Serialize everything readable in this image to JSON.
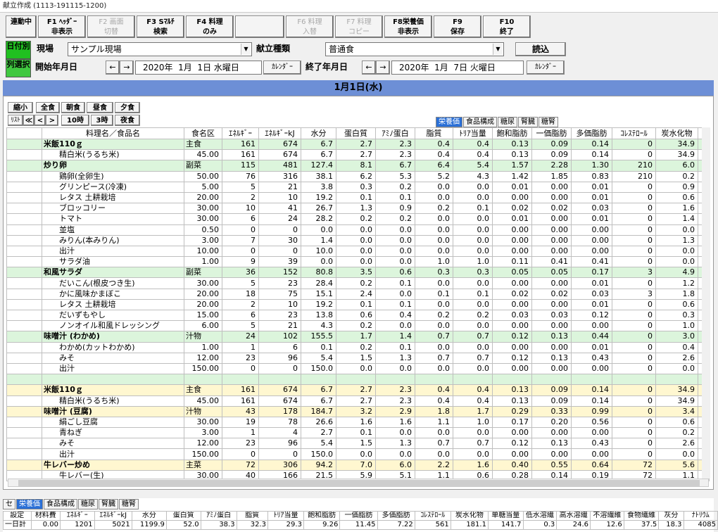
{
  "window": {
    "title": "献立作成 (1113-191115-1200)"
  },
  "fkeys": [
    {
      "l1": "連動中",
      "l2": "",
      "disabled": false
    },
    {
      "l1": "F1 ﾍｯﾀﾞｰ",
      "l2": "非表示",
      "disabled": false
    },
    {
      "l1": "F2  画面",
      "l2": "切替",
      "disabled": true
    },
    {
      "l1": "F3  Sﾏﾙﾁ",
      "l2": "検索",
      "disabled": false
    },
    {
      "l1": "F4  料理",
      "l2": "のみ",
      "disabled": false
    },
    {
      "l1": "",
      "l2": "",
      "disabled": false
    },
    {
      "l1": "F6  料理",
      "l2": "入替",
      "disabled": true
    },
    {
      "l1": "F7  料理",
      "l2": "コピー",
      "disabled": true
    },
    {
      "l1": "F8栄養価",
      "l2": "非表示",
      "disabled": false
    },
    {
      "l1": "F9",
      "l2": "保存",
      "disabled": false
    },
    {
      "l1": "F10",
      "l2": "終了",
      "disabled": false
    }
  ],
  "header": {
    "day_btn": "日付別",
    "list_btn": "列選択",
    "site_label": "現場",
    "site_value": "サンプル現場",
    "menu_type_label": "献立種類",
    "menu_type_value": "普通食",
    "load_btn": "読込",
    "start_label": "開始年月日",
    "start_date": "2020年  1月  1日 水曜日",
    "end_label": "終了年月日",
    "end_date": "2020年  1月  7日 火曜日",
    "calendar_btn": "ｶﾚﾝﾀﾞｰ",
    "prev": "←",
    "next": "→"
  },
  "day_title": "1月1日(水)",
  "meal_buttons": {
    "shrink": "縮小",
    "all": "全食",
    "breakfast": "朝食",
    "lunch": "昼食",
    "dinner": "夕食",
    "list": "ﾘｽﾄ",
    "first": "≪",
    "prev": "<",
    "next": ">",
    "ten": "10時",
    "three": "3時",
    "night": "夜食"
  },
  "top_tabs": [
    "栄養価",
    "食品構成",
    "糖尿",
    "腎臓",
    "糖腎"
  ],
  "columns": [
    "料理名／食品名",
    "食名区",
    "ｴﾈﾙｷﾞｰ",
    "ｴﾈﾙｷﾞｰkJ",
    "水分",
    "蛋白質",
    "ｱﾐﾉ蛋白",
    "脂質",
    "ﾄﾘｱ当量",
    "飽和脂肪",
    "一価脂肪",
    "多価脂肪",
    "ｺﾚｽﾃﾛｰﾙ",
    "炭水化物"
  ],
  "rows": [
    {
      "t": "dish",
      "c": "g",
      "name": "米飯110ｇ",
      "cat": "主食",
      "v": [
        "161",
        "674",
        "6.7",
        "2.7",
        "2.3",
        "0.4",
        "0.4",
        "0.13",
        "0.09",
        "0.14",
        "0",
        "34.9"
      ]
    },
    {
      "t": "ing",
      "name": "精白米(うるち米)",
      "cat": "45.00",
      "v": [
        "161",
        "674",
        "6.7",
        "2.7",
        "2.3",
        "0.4",
        "0.4",
        "0.13",
        "0.09",
        "0.14",
        "0",
        "34.9"
      ]
    },
    {
      "t": "dish",
      "c": "g",
      "name": "炒り卵",
      "cat": "副菜",
      "v": [
        "115",
        "481",
        "127.4",
        "8.1",
        "6.7",
        "6.4",
        "5.4",
        "1.57",
        "2.28",
        "1.30",
        "210",
        "6.0"
      ]
    },
    {
      "t": "ing",
      "name": "鶏卵(全卵生)",
      "cat": "50.00",
      "v": [
        "76",
        "316",
        "38.1",
        "6.2",
        "5.3",
        "5.2",
        "4.3",
        "1.42",
        "1.85",
        "0.83",
        "210",
        "0.2"
      ]
    },
    {
      "t": "ing",
      "name": "グリンピース(冷凍)",
      "cat": "5.00",
      "v": [
        "5",
        "21",
        "3.8",
        "0.3",
        "0.2",
        "0.0",
        "0.0",
        "0.01",
        "0.00",
        "0.01",
        "0",
        "0.9"
      ]
    },
    {
      "t": "ing",
      "name": "レタス 土耕栽培",
      "cat": "20.00",
      "v": [
        "2",
        "10",
        "19.2",
        "0.1",
        "0.1",
        "0.0",
        "0.0",
        "0.00",
        "0.00",
        "0.01",
        "0",
        "0.6"
      ]
    },
    {
      "t": "ing",
      "name": "ブロッコリー",
      "cat": "30.00",
      "v": [
        "10",
        "41",
        "26.7",
        "1.3",
        "0.9",
        "0.2",
        "0.1",
        "0.02",
        "0.02",
        "0.03",
        "0",
        "1.6"
      ]
    },
    {
      "t": "ing",
      "name": "トマト",
      "cat": "30.00",
      "v": [
        "6",
        "24",
        "28.2",
        "0.2",
        "0.2",
        "0.0",
        "0.0",
        "0.01",
        "0.00",
        "0.01",
        "0",
        "1.4"
      ]
    },
    {
      "t": "ing",
      "name": "並塩",
      "cat": "0.50",
      "v": [
        "0",
        "0",
        "0.0",
        "0.0",
        "0.0",
        "0.0",
        "0.0",
        "0.00",
        "0.00",
        "0.00",
        "0",
        "0.0"
      ]
    },
    {
      "t": "ing",
      "name": "みりん(本みりん)",
      "cat": "3.00",
      "v": [
        "7",
        "30",
        "1.4",
        "0.0",
        "0.0",
        "0.0",
        "0.0",
        "0.00",
        "0.00",
        "0.00",
        "0",
        "1.3"
      ]
    },
    {
      "t": "ing",
      "name": "出汁",
      "cat": "10.00",
      "v": [
        "0",
        "0",
        "10.0",
        "0.0",
        "0.0",
        "0.0",
        "0.0",
        "0.00",
        "0.00",
        "0.00",
        "0",
        "0.0"
      ]
    },
    {
      "t": "ing",
      "name": "サラダ油",
      "cat": "1.00",
      "v": [
        "9",
        "39",
        "0.0",
        "0.0",
        "0.0",
        "1.0",
        "1.0",
        "0.11",
        "0.41",
        "0.41",
        "0",
        "0.0"
      ]
    },
    {
      "t": "dish",
      "c": "g",
      "name": "和風サラダ",
      "cat": "副菜",
      "v": [
        "36",
        "152",
        "80.8",
        "3.5",
        "0.6",
        "0.3",
        "0.3",
        "0.05",
        "0.05",
        "0.17",
        "3",
        "4.9"
      ]
    },
    {
      "t": "ing",
      "name": "だいこん(根皮つき生)",
      "cat": "30.00",
      "v": [
        "5",
        "23",
        "28.4",
        "0.2",
        "0.1",
        "0.0",
        "0.0",
        "0.00",
        "0.00",
        "0.01",
        "0",
        "1.2"
      ]
    },
    {
      "t": "ing",
      "name": "かに風味かまぼこ",
      "cat": "20.00",
      "v": [
        "18",
        "75",
        "15.1",
        "2.4",
        "0.0",
        "0.1",
        "0.1",
        "0.02",
        "0.02",
        "0.03",
        "3",
        "1.8"
      ]
    },
    {
      "t": "ing",
      "name": "レタス 土耕栽培",
      "cat": "20.00",
      "v": [
        "2",
        "10",
        "19.2",
        "0.1",
        "0.1",
        "0.0",
        "0.0",
        "0.00",
        "0.00",
        "0.01",
        "0",
        "0.6"
      ]
    },
    {
      "t": "ing",
      "name": "だいずもやし",
      "cat": "15.00",
      "v": [
        "6",
        "23",
        "13.8",
        "0.6",
        "0.4",
        "0.2",
        "0.2",
        "0.03",
        "0.03",
        "0.12",
        "0",
        "0.3"
      ]
    },
    {
      "t": "ing",
      "name": "ノンオイル和風ドレッシング",
      "cat": "6.00",
      "v": [
        "5",
        "21",
        "4.3",
        "0.2",
        "0.0",
        "0.0",
        "0.0",
        "0.00",
        "0.00",
        "0.00",
        "0",
        "1.0"
      ]
    },
    {
      "t": "dish",
      "c": "g",
      "name": "味噌汁 (わかめ)",
      "cat": "汁物",
      "v": [
        "24",
        "102",
        "155.5",
        "1.7",
        "1.4",
        "0.7",
        "0.7",
        "0.12",
        "0.13",
        "0.44",
        "0",
        "3.0"
      ]
    },
    {
      "t": "ing",
      "name": "わかめ(カットわかめ)",
      "cat": "1.00",
      "v": [
        "1",
        "6",
        "0.1",
        "0.2",
        "0.1",
        "0.0",
        "0.0",
        "0.00",
        "0.00",
        "0.01",
        "0",
        "0.4"
      ]
    },
    {
      "t": "ing",
      "name": "みそ",
      "cat": "12.00",
      "v": [
        "23",
        "96",
        "5.4",
        "1.5",
        "1.3",
        "0.7",
        "0.7",
        "0.12",
        "0.13",
        "0.43",
        "0",
        "2.6"
      ]
    },
    {
      "t": "ing",
      "name": "出汁",
      "cat": "150.00",
      "v": [
        "0",
        "0",
        "150.0",
        "0.0",
        "0.0",
        "0.0",
        "0.0",
        "0.00",
        "0.00",
        "0.00",
        "0",
        "0.0"
      ]
    },
    {
      "t": "spacer"
    },
    {
      "t": "dish",
      "c": "y",
      "name": "米飯110ｇ",
      "cat": "主食",
      "v": [
        "161",
        "674",
        "6.7",
        "2.7",
        "2.3",
        "0.4",
        "0.4",
        "0.13",
        "0.09",
        "0.14",
        "0",
        "34.9"
      ]
    },
    {
      "t": "ing",
      "name": "精白米(うるち米)",
      "cat": "45.00",
      "v": [
        "161",
        "674",
        "6.7",
        "2.7",
        "2.3",
        "0.4",
        "0.4",
        "0.13",
        "0.09",
        "0.14",
        "0",
        "34.9"
      ]
    },
    {
      "t": "dish",
      "c": "y",
      "name": "味噌汁 (豆腐)",
      "cat": "汁物",
      "v": [
        "43",
        "178",
        "184.7",
        "3.2",
        "2.9",
        "1.8",
        "1.7",
        "0.29",
        "0.33",
        "0.99",
        "0",
        "3.4"
      ]
    },
    {
      "t": "ing",
      "name": "絹ごし豆腐",
      "cat": "30.00",
      "v": [
        "19",
        "78",
        "26.6",
        "1.6",
        "1.6",
        "1.1",
        "1.0",
        "0.17",
        "0.20",
        "0.56",
        "0",
        "0.6"
      ]
    },
    {
      "t": "ing",
      "name": "青ねぎ",
      "cat": "3.00",
      "v": [
        "1",
        "4",
        "2.7",
        "0.1",
        "0.0",
        "0.0",
        "0.0",
        "0.00",
        "0.00",
        "0.00",
        "0",
        "0.2"
      ]
    },
    {
      "t": "ing",
      "name": "みそ",
      "cat": "12.00",
      "v": [
        "23",
        "96",
        "5.4",
        "1.5",
        "1.3",
        "0.7",
        "0.7",
        "0.12",
        "0.13",
        "0.43",
        "0",
        "2.6"
      ]
    },
    {
      "t": "ing",
      "name": "出汁",
      "cat": "150.00",
      "v": [
        "0",
        "0",
        "150.0",
        "0.0",
        "0.0",
        "0.0",
        "0.0",
        "0.00",
        "0.00",
        "0.00",
        "0",
        "0.0"
      ]
    },
    {
      "t": "dish",
      "c": "y",
      "name": "牛レバー炒め",
      "cat": "主菜",
      "v": [
        "72",
        "306",
        "94.2",
        "7.0",
        "6.0",
        "2.2",
        "1.6",
        "0.40",
        "0.55",
        "0.64",
        "72",
        "5.6"
      ]
    },
    {
      "t": "ing",
      "name": "牛レバー(生)",
      "cat": "30.00",
      "v": [
        "40",
        "166",
        "21.5",
        "5.9",
        "5.1",
        "1.1",
        "0.6",
        "0.28",
        "0.14",
        "0.19",
        "72",
        "1.1"
      ]
    }
  ],
  "bottom_tabs": [
    "セ",
    "栄養価",
    "食品構成",
    "糖尿",
    "腎臓",
    "糖腎"
  ],
  "summary_headers": [
    "設定",
    "材料費",
    "ｴﾈﾙｷﾞｰ",
    "ｴﾈﾙｷﾞｰkJ",
    "水分",
    "蛋白質",
    "ｱﾐﾉ蛋白",
    "脂質",
    "ﾄﾘｱ当量",
    "飽和脂肪",
    "一価脂肪",
    "多価脂肪",
    "ｺﾚｽﾃﾛｰﾙ",
    "炭水化物",
    "単糖当量",
    "低水溶繊",
    "高水溶繊",
    "不溶繊維",
    "食物繊維",
    "灰分",
    "ﾅﾄﾘｳﾑ"
  ],
  "summary_row": [
    "一日計",
    "0.00",
    "1201",
    "5021",
    "1199.9",
    "52.0",
    "38.3",
    "32.3",
    "29.3",
    "9.26",
    "11.45",
    "7.22",
    "561",
    "181.1",
    "141.7",
    "0.3",
    "24.6",
    "12.6",
    "37.5",
    "18.3",
    "4085"
  ]
}
